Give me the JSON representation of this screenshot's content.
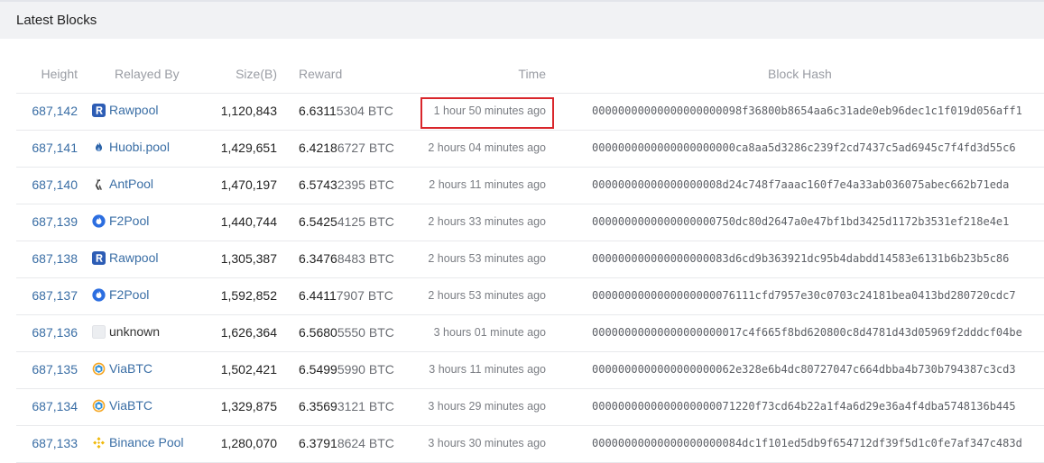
{
  "panel": {
    "title": "Latest Blocks"
  },
  "columns": {
    "height": "Height",
    "relayed_by": "Relayed By",
    "size": "Size(B)",
    "reward": "Reward",
    "time": "Time",
    "hash": "Block Hash"
  },
  "rows": [
    {
      "height": "687,142",
      "pool": "Rawpool",
      "pool_icon": "rawpool-icon",
      "size": "1,120,843",
      "reward_main": "6.6311",
      "reward_rest": "5304 BTC",
      "time": "1 hour 50 minutes ago",
      "hash": "00000000000000000000098f36800b8654aa6c31ade0eb96dec1c1f019d056aff1"
    },
    {
      "height": "687,141",
      "pool": "Huobi.pool",
      "pool_icon": "huobi-icon",
      "size": "1,429,651",
      "reward_main": "6.4218",
      "reward_rest": "6727 BTC",
      "time": "2 hours 04 minutes ago",
      "hash": "0000000000000000000000ca8aa5d3286c239f2cd7437c5ad6945c7f4fd3d55c6"
    },
    {
      "height": "687,140",
      "pool": "AntPool",
      "pool_icon": "antpool-icon",
      "size": "1,470,197",
      "reward_main": "6.5743",
      "reward_rest": "2395 BTC",
      "time": "2 hours 11 minutes ago",
      "hash": "00000000000000000008d24c748f7aaac160f7e4a33ab036075abec662b71eda"
    },
    {
      "height": "687,139",
      "pool": "F2Pool",
      "pool_icon": "f2pool-icon",
      "size": "1,440,744",
      "reward_main": "6.5425",
      "reward_rest": "4125 BTC",
      "time": "2 hours 33 minutes ago",
      "hash": "0000000000000000000750dc80d2647a0e47bf1bd3425d1172b3531ef218e4e1"
    },
    {
      "height": "687,138",
      "pool": "Rawpool",
      "pool_icon": "rawpool-icon",
      "size": "1,305,387",
      "reward_main": "6.3476",
      "reward_rest": "8483 BTC",
      "time": "2 hours 53 minutes ago",
      "hash": "000000000000000000083d6cd9b363921dc95b4dabdd14583e6131b6b23b5c86"
    },
    {
      "height": "687,137",
      "pool": "F2Pool",
      "pool_icon": "f2pool-icon",
      "size": "1,592,852",
      "reward_main": "6.4411",
      "reward_rest": "7907 BTC",
      "time": "2 hours 53 minutes ago",
      "hash": "0000000000000000000076111cfd7957e30c0703c24181bea0413bd280720cdc7"
    },
    {
      "height": "687,136",
      "pool": "unknown",
      "pool_icon": "unknown-icon",
      "size": "1,626,364",
      "reward_main": "6.5680",
      "reward_rest": "5550 BTC",
      "time": "3 hours 01 minute ago",
      "hash": "00000000000000000000017c4f665f8bd620800c8d4781d43d05969f2dddcf04be"
    },
    {
      "height": "687,135",
      "pool": "ViaBTC",
      "pool_icon": "viabtc-icon",
      "size": "1,502,421",
      "reward_main": "6.5499",
      "reward_rest": "5990 BTC",
      "time": "3 hours 11 minutes ago",
      "hash": "0000000000000000000062e328e6b4dc80727047c664dbba4b730b794387c3cd3"
    },
    {
      "height": "687,134",
      "pool": "ViaBTC",
      "pool_icon": "viabtc-icon",
      "size": "1,329,875",
      "reward_main": "6.3569",
      "reward_rest": "3121 BTC",
      "time": "3 hours 29 minutes ago",
      "hash": "0000000000000000000071220f73cd64b22a1f4a6d29e36a4f4dba5748136b445"
    },
    {
      "height": "687,133",
      "pool": "Binance Pool",
      "pool_icon": "binance-icon",
      "size": "1,280,070",
      "reward_main": "6.3791",
      "reward_rest": "8624 BTC",
      "time": "3 hours 30 minutes ago",
      "hash": "00000000000000000000084dc1f101ed5db9f654712df39f5d1c0fe7af347c483d"
    }
  ],
  "colors": {
    "link": "#3a6ea5",
    "highlight": "#d9262b",
    "header_bg": "#f1f2f4"
  }
}
